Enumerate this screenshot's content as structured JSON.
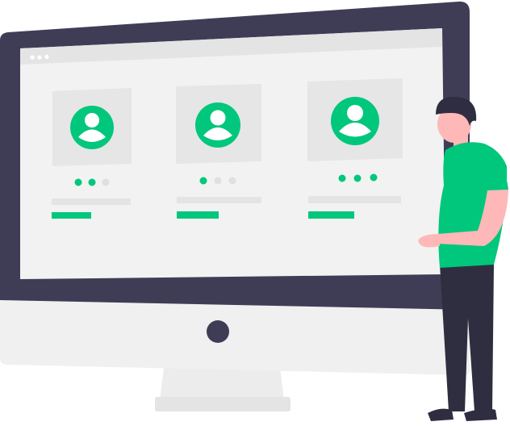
{
  "colors": {
    "accent": "#00c77c",
    "bezel": "#3f3d56",
    "screen": "#f2f2f2",
    "card": "#e6e6e6",
    "dot_inactive": "#e0e0e0",
    "stand": "#f0f0f0",
    "skin": "#ffb8b8",
    "hair": "#2f2e41",
    "pants": "#2f2e41",
    "white": "#ffffff"
  },
  "window": {
    "controls": [
      "close-dot-icon",
      "minimize-dot-icon",
      "maximize-dot-icon"
    ]
  },
  "profiles": [
    {
      "avatar_icon": "user-avatar-icon",
      "active_dot": 1,
      "dot_count": 3
    },
    {
      "avatar_icon": "user-avatar-icon",
      "active_dot": 0,
      "dot_count": 3
    },
    {
      "avatar_icon": "user-avatar-icon",
      "active_dot": 2,
      "dot_count": 3
    }
  ],
  "monitor": {
    "power_button_icon": "power-button-icon"
  }
}
